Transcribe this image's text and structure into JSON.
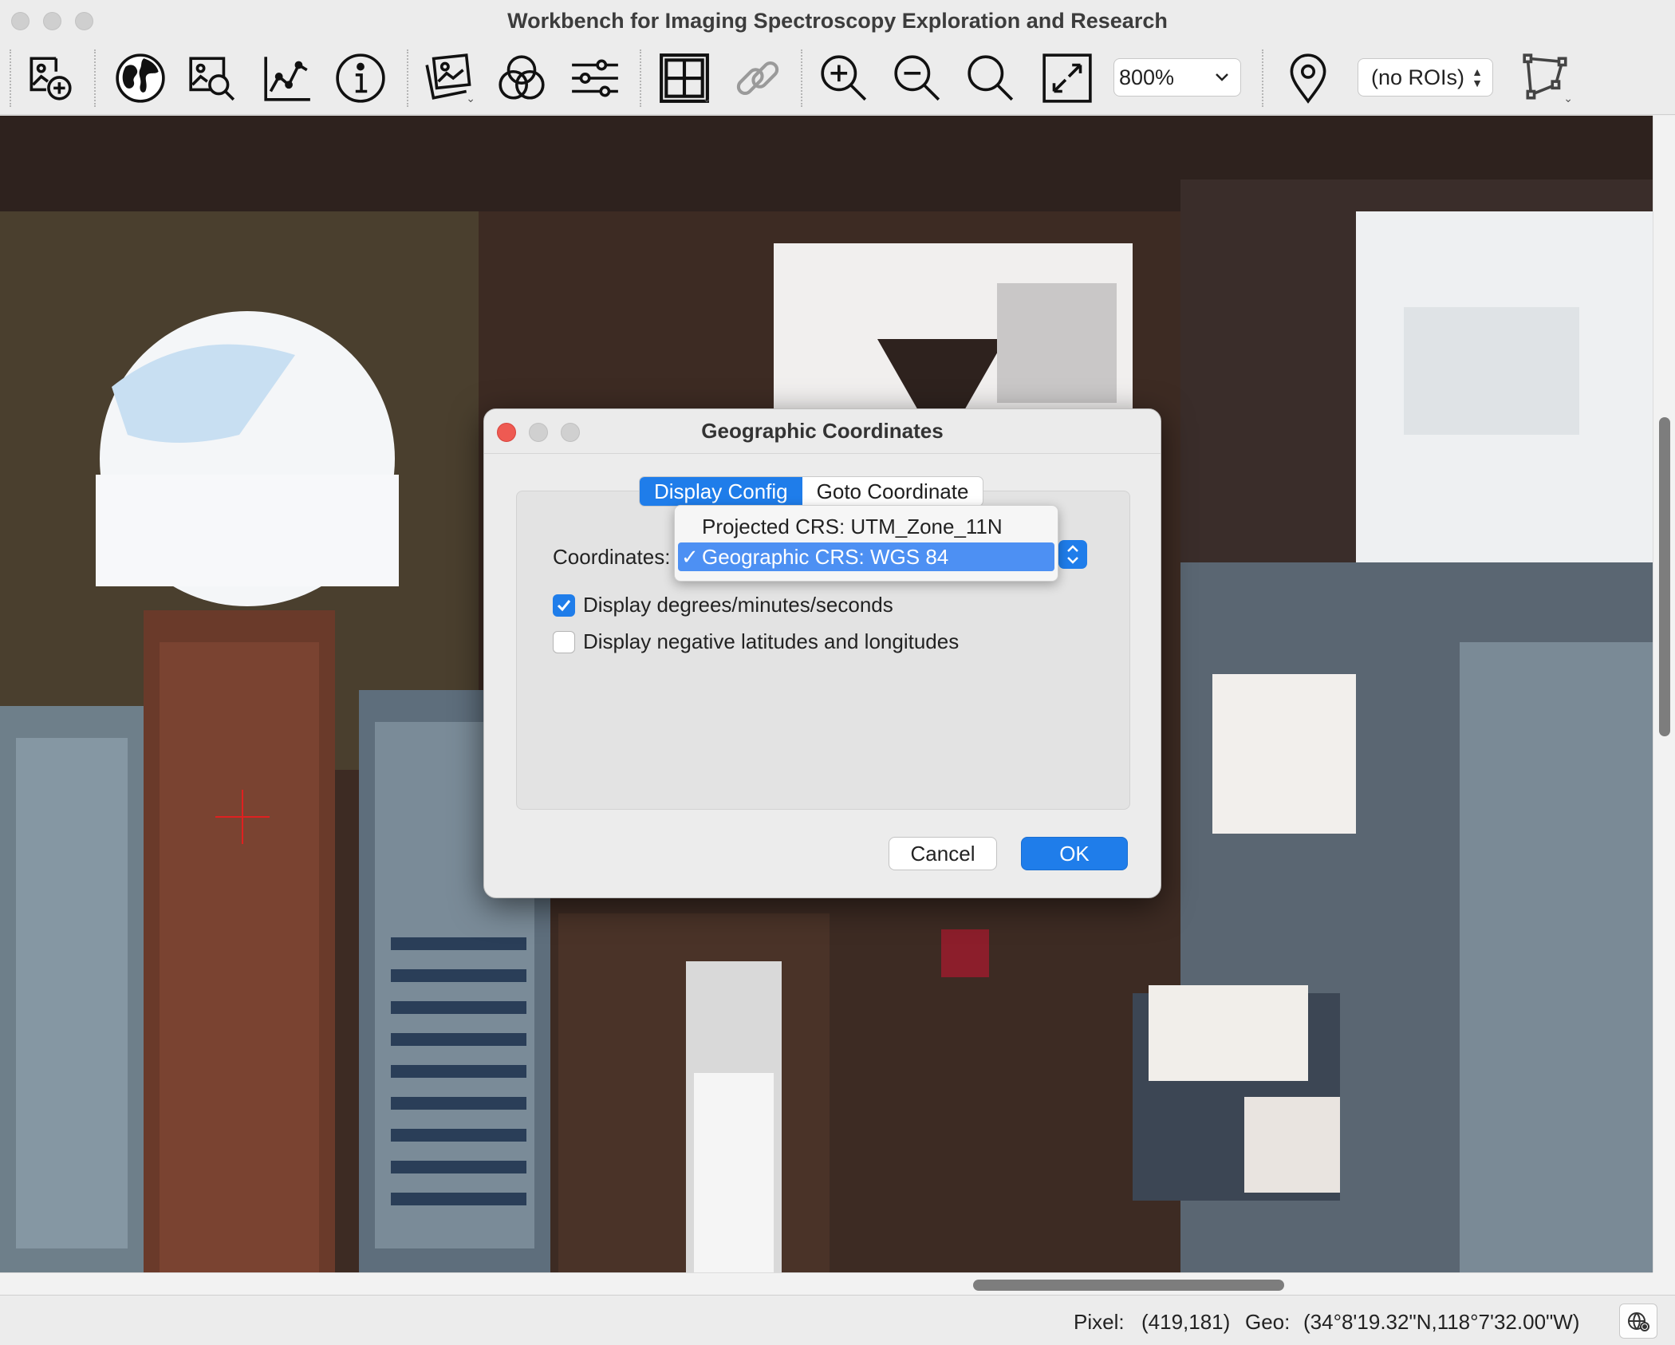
{
  "app": {
    "title": "Workbench for Imaging Spectroscopy Exploration and Research"
  },
  "toolbar": {
    "icons": [
      "add-image-icon",
      "globe-icon",
      "image-search-icon",
      "line-chart-icon",
      "info-icon",
      "image-stack-icon",
      "color-channels-icon",
      "sliders-icon",
      "grid-icon",
      "link-icon",
      "zoom-in-icon",
      "zoom-out-icon",
      "zoom-fit-icon",
      "fullscreen-icon",
      "location-pin-icon",
      "roi-polygon-icon"
    ],
    "zoom_value": "800%",
    "roi_value": "(no ROIs)"
  },
  "status": {
    "pixel_label": "Pixel:",
    "pixel_value": "(419,181)",
    "geo_label": "Geo:",
    "geo_value": "(34°8'19.32\"N,118°7'32.00\"W)"
  },
  "dialog": {
    "title": "Geographic Coordinates",
    "tabs": [
      {
        "label": "Display Config",
        "active": true
      },
      {
        "label": "Goto Coordinate",
        "active": false
      }
    ],
    "coordinates_label": "Coordinates:",
    "crs_options": [
      {
        "label": "Projected CRS:  UTM_Zone_11N",
        "selected": false
      },
      {
        "label": "Geographic CRS:  WGS 84",
        "selected": true
      }
    ],
    "checkboxes": [
      {
        "label": "Display degrees/minutes/seconds",
        "checked": true
      },
      {
        "label": "Display negative latitudes and longitudes",
        "checked": false
      }
    ],
    "cancel_label": "Cancel",
    "ok_label": "OK"
  },
  "colors": {
    "accent": "#1f7dea",
    "menu_highlight": "#4d90f3",
    "close_dot": "#ee5a52"
  }
}
